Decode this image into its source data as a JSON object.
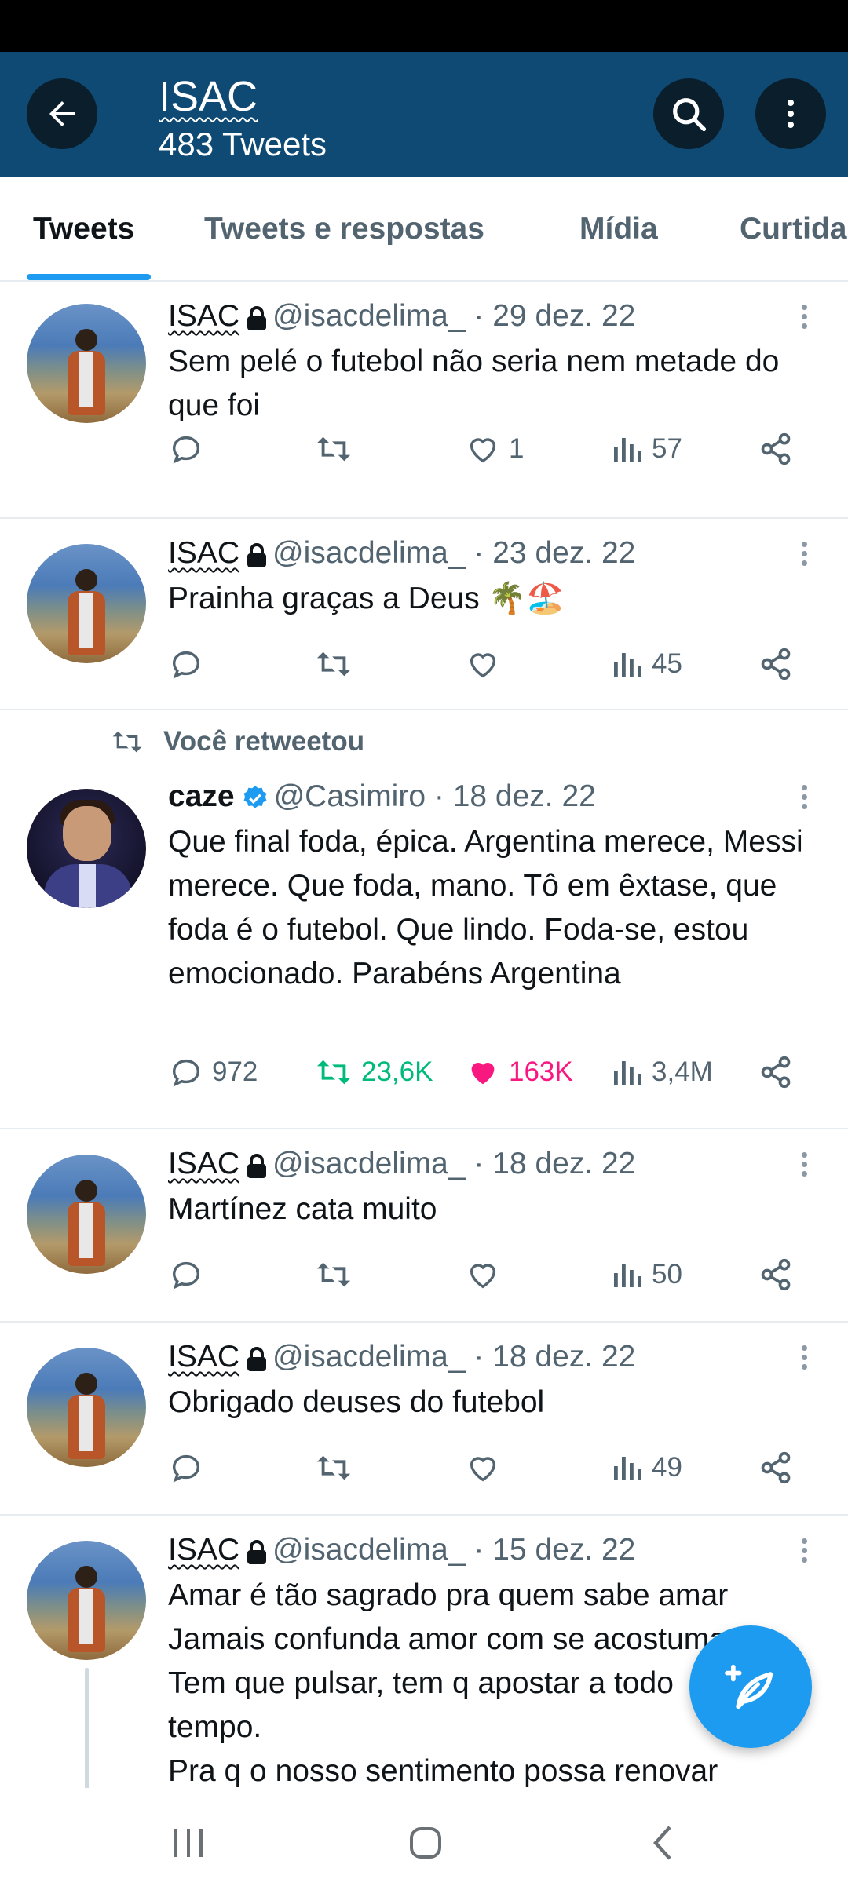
{
  "header": {
    "title": "ISAC",
    "subtitle": "483 Tweets",
    "back_icon": "arrow-left-icon",
    "search_icon": "search-icon",
    "more_icon": "more-vertical-icon"
  },
  "tabs": [
    {
      "label": "Tweets",
      "active": true
    },
    {
      "label": "Tweets e respostas",
      "active": false
    },
    {
      "label": "Mídia",
      "active": false
    },
    {
      "label": "Curtidas",
      "active": false
    }
  ],
  "tweets": [
    {
      "name": "ISAC",
      "handle": "@isacdelima_",
      "date": "· 29 dez. 22",
      "protected": true,
      "text": "Sem pelé o futebol não seria nem metade do que foi",
      "replies": "",
      "retweets": "",
      "likes": "1",
      "views": "57"
    },
    {
      "name": "ISAC",
      "handle": "@isacdelima_",
      "date": "· 23 dez. 22",
      "protected": true,
      "text": "Prainha graças a Deus 🌴🏖️",
      "replies": "",
      "retweets": "",
      "likes": "",
      "views": "45"
    },
    {
      "retweet_label": "Você retweetou",
      "name": "caze",
      "handle": "@Casimiro",
      "date": "· 18 dez. 22",
      "verified": true,
      "text": "Que final foda, épica. Argentina merece, Messi merece. Que foda, mano. Tô em êxtase, que foda é o futebol. Que lindo. Foda-se, estou emocionado. Parabéns Argentina",
      "replies": "972",
      "retweets": "23,6K",
      "likes": "163K",
      "views": "3,4M"
    },
    {
      "name": "ISAC",
      "handle": "@isacdelima_",
      "date": "· 18 dez. 22",
      "protected": true,
      "text": "Martínez cata muito",
      "replies": "",
      "retweets": "",
      "likes": "",
      "views": "50"
    },
    {
      "name": "ISAC",
      "handle": "@isacdelima_",
      "date": "· 18 dez. 22",
      "protected": true,
      "text": "Obrigado deuses do futebol",
      "replies": "",
      "retweets": "",
      "likes": "",
      "views": "49"
    },
    {
      "name": "ISAC",
      "handle": "@isacdelima_",
      "date": "· 15 dez. 22",
      "protected": true,
      "text_lines": [
        "Amar é tão sagrado pra quem sabe amar",
        "Jamais confunda amor com se acostumar",
        "Tem que pulsar, tem q apostar a todo",
        "tempo.",
        "Pra q o nosso sentimento possa renovar"
      ]
    }
  ],
  "colors": {
    "header_bg": "#0e4a73",
    "accent": "#1d9bf0",
    "retweet_active": "#00ba7c",
    "like_active": "#f91880"
  },
  "fab_icon": "compose-tweet-icon",
  "navbar": [
    "recent-apps-icon",
    "home-icon",
    "back-icon"
  ]
}
